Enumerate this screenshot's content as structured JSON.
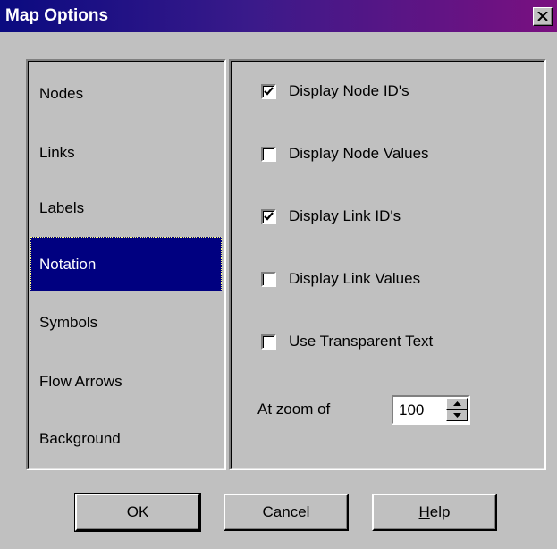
{
  "window": {
    "title": "Map Options",
    "title_gradient": [
      "#0a0a80",
      "#7a1080"
    ]
  },
  "nav": {
    "items": [
      {
        "label": "Nodes",
        "selected": false
      },
      {
        "label": "Links",
        "selected": false
      },
      {
        "label": "Labels",
        "selected": false
      },
      {
        "label": "Notation",
        "selected": true
      },
      {
        "label": "Symbols",
        "selected": false
      },
      {
        "label": "Flow Arrows",
        "selected": false
      },
      {
        "label": "Background",
        "selected": false
      }
    ],
    "selected_color": "#000080"
  },
  "options": {
    "checkboxes": [
      {
        "label": "Display Node ID's",
        "checked": true
      },
      {
        "label": "Display Node Values",
        "checked": false
      },
      {
        "label": "Display Link ID's",
        "checked": true
      },
      {
        "label": "Display Link Values",
        "checked": false
      },
      {
        "label": "Use Transparent Text",
        "checked": false
      }
    ],
    "zoom_label": "At zoom of",
    "zoom_value": "100"
  },
  "buttons": {
    "ok": "OK",
    "cancel": "Cancel",
    "help_accel": "H",
    "help_rest": "elp"
  },
  "icons": {
    "close": "close-icon",
    "check": "checkmark-icon",
    "spin_up": "triangle-up-icon",
    "spin_down": "triangle-down-icon"
  }
}
